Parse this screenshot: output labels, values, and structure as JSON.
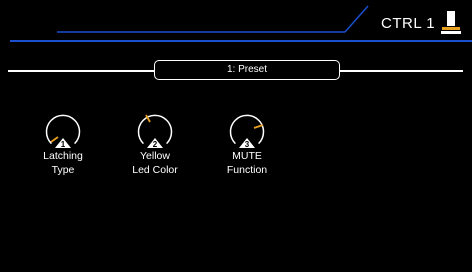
{
  "header": {
    "title": "CTRL 1",
    "icon": "footswitch-icon",
    "accent_color": "#1a4fd0"
  },
  "preset": {
    "label": "1: Preset"
  },
  "knobs": [
    {
      "badge": "1",
      "label_line1": "Latching",
      "label_line2": "Type",
      "indicator_color": "#e8a020"
    },
    {
      "badge": "2",
      "label_line1": "Yellow",
      "label_line2": "Led Color",
      "indicator_color": "#e8a020"
    },
    {
      "badge": "3",
      "label_line1": "MUTE",
      "label_line2": "Function",
      "indicator_color": "#e8a020"
    }
  ]
}
